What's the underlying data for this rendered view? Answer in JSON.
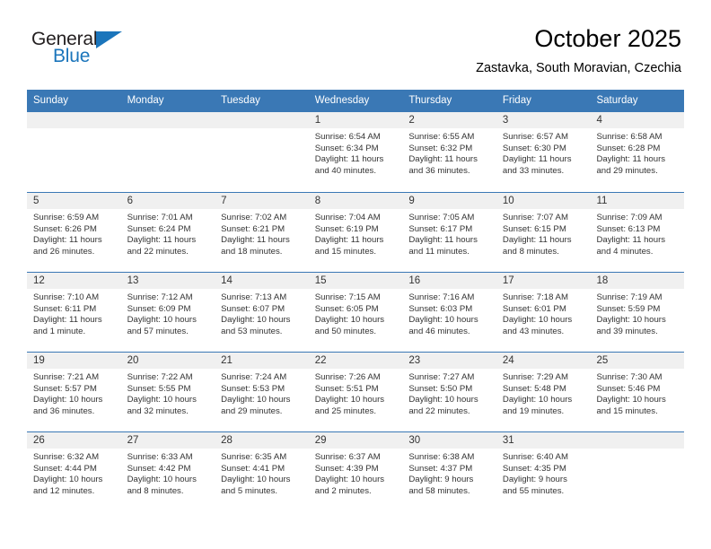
{
  "brand": {
    "name_part1": "General",
    "name_part2": "Blue",
    "triangle_icon": "triangle-icon",
    "accent_color": "#1b75bb"
  },
  "header": {
    "title": "October 2025",
    "subtitle": "Zastavka, South Moravian, Czechia"
  },
  "colors": {
    "header_blue": "#3a78b5",
    "daynum_band": "#f0f0f0",
    "text": "#333333"
  },
  "weekdays": [
    "Sunday",
    "Monday",
    "Tuesday",
    "Wednesday",
    "Thursday",
    "Friday",
    "Saturday"
  ],
  "weeks": [
    [
      {
        "day": "",
        "lines": []
      },
      {
        "day": "",
        "lines": []
      },
      {
        "day": "",
        "lines": []
      },
      {
        "day": "1",
        "lines": [
          "Sunrise: 6:54 AM",
          "Sunset: 6:34 PM",
          "Daylight: 11 hours",
          "and 40 minutes."
        ]
      },
      {
        "day": "2",
        "lines": [
          "Sunrise: 6:55 AM",
          "Sunset: 6:32 PM",
          "Daylight: 11 hours",
          "and 36 minutes."
        ]
      },
      {
        "day": "3",
        "lines": [
          "Sunrise: 6:57 AM",
          "Sunset: 6:30 PM",
          "Daylight: 11 hours",
          "and 33 minutes."
        ]
      },
      {
        "day": "4",
        "lines": [
          "Sunrise: 6:58 AM",
          "Sunset: 6:28 PM",
          "Daylight: 11 hours",
          "and 29 minutes."
        ]
      }
    ],
    [
      {
        "day": "5",
        "lines": [
          "Sunrise: 6:59 AM",
          "Sunset: 6:26 PM",
          "Daylight: 11 hours",
          "and 26 minutes."
        ]
      },
      {
        "day": "6",
        "lines": [
          "Sunrise: 7:01 AM",
          "Sunset: 6:24 PM",
          "Daylight: 11 hours",
          "and 22 minutes."
        ]
      },
      {
        "day": "7",
        "lines": [
          "Sunrise: 7:02 AM",
          "Sunset: 6:21 PM",
          "Daylight: 11 hours",
          "and 18 minutes."
        ]
      },
      {
        "day": "8",
        "lines": [
          "Sunrise: 7:04 AM",
          "Sunset: 6:19 PM",
          "Daylight: 11 hours",
          "and 15 minutes."
        ]
      },
      {
        "day": "9",
        "lines": [
          "Sunrise: 7:05 AM",
          "Sunset: 6:17 PM",
          "Daylight: 11 hours",
          "and 11 minutes."
        ]
      },
      {
        "day": "10",
        "lines": [
          "Sunrise: 7:07 AM",
          "Sunset: 6:15 PM",
          "Daylight: 11 hours",
          "and 8 minutes."
        ]
      },
      {
        "day": "11",
        "lines": [
          "Sunrise: 7:09 AM",
          "Sunset: 6:13 PM",
          "Daylight: 11 hours",
          "and 4 minutes."
        ]
      }
    ],
    [
      {
        "day": "12",
        "lines": [
          "Sunrise: 7:10 AM",
          "Sunset: 6:11 PM",
          "Daylight: 11 hours",
          "and 1 minute."
        ]
      },
      {
        "day": "13",
        "lines": [
          "Sunrise: 7:12 AM",
          "Sunset: 6:09 PM",
          "Daylight: 10 hours",
          "and 57 minutes."
        ]
      },
      {
        "day": "14",
        "lines": [
          "Sunrise: 7:13 AM",
          "Sunset: 6:07 PM",
          "Daylight: 10 hours",
          "and 53 minutes."
        ]
      },
      {
        "day": "15",
        "lines": [
          "Sunrise: 7:15 AM",
          "Sunset: 6:05 PM",
          "Daylight: 10 hours",
          "and 50 minutes."
        ]
      },
      {
        "day": "16",
        "lines": [
          "Sunrise: 7:16 AM",
          "Sunset: 6:03 PM",
          "Daylight: 10 hours",
          "and 46 minutes."
        ]
      },
      {
        "day": "17",
        "lines": [
          "Sunrise: 7:18 AM",
          "Sunset: 6:01 PM",
          "Daylight: 10 hours",
          "and 43 minutes."
        ]
      },
      {
        "day": "18",
        "lines": [
          "Sunrise: 7:19 AM",
          "Sunset: 5:59 PM",
          "Daylight: 10 hours",
          "and 39 minutes."
        ]
      }
    ],
    [
      {
        "day": "19",
        "lines": [
          "Sunrise: 7:21 AM",
          "Sunset: 5:57 PM",
          "Daylight: 10 hours",
          "and 36 minutes."
        ]
      },
      {
        "day": "20",
        "lines": [
          "Sunrise: 7:22 AM",
          "Sunset: 5:55 PM",
          "Daylight: 10 hours",
          "and 32 minutes."
        ]
      },
      {
        "day": "21",
        "lines": [
          "Sunrise: 7:24 AM",
          "Sunset: 5:53 PM",
          "Daylight: 10 hours",
          "and 29 minutes."
        ]
      },
      {
        "day": "22",
        "lines": [
          "Sunrise: 7:26 AM",
          "Sunset: 5:51 PM",
          "Daylight: 10 hours",
          "and 25 minutes."
        ]
      },
      {
        "day": "23",
        "lines": [
          "Sunrise: 7:27 AM",
          "Sunset: 5:50 PM",
          "Daylight: 10 hours",
          "and 22 minutes."
        ]
      },
      {
        "day": "24",
        "lines": [
          "Sunrise: 7:29 AM",
          "Sunset: 5:48 PM",
          "Daylight: 10 hours",
          "and 19 minutes."
        ]
      },
      {
        "day": "25",
        "lines": [
          "Sunrise: 7:30 AM",
          "Sunset: 5:46 PM",
          "Daylight: 10 hours",
          "and 15 minutes."
        ]
      }
    ],
    [
      {
        "day": "26",
        "lines": [
          "Sunrise: 6:32 AM",
          "Sunset: 4:44 PM",
          "Daylight: 10 hours",
          "and 12 minutes."
        ]
      },
      {
        "day": "27",
        "lines": [
          "Sunrise: 6:33 AM",
          "Sunset: 4:42 PM",
          "Daylight: 10 hours",
          "and 8 minutes."
        ]
      },
      {
        "day": "28",
        "lines": [
          "Sunrise: 6:35 AM",
          "Sunset: 4:41 PM",
          "Daylight: 10 hours",
          "and 5 minutes."
        ]
      },
      {
        "day": "29",
        "lines": [
          "Sunrise: 6:37 AM",
          "Sunset: 4:39 PM",
          "Daylight: 10 hours",
          "and 2 minutes."
        ]
      },
      {
        "day": "30",
        "lines": [
          "Sunrise: 6:38 AM",
          "Sunset: 4:37 PM",
          "Daylight: 9 hours",
          "and 58 minutes."
        ]
      },
      {
        "day": "31",
        "lines": [
          "Sunrise: 6:40 AM",
          "Sunset: 4:35 PM",
          "Daylight: 9 hours",
          "and 55 minutes."
        ]
      },
      {
        "day": "",
        "lines": []
      }
    ]
  ]
}
